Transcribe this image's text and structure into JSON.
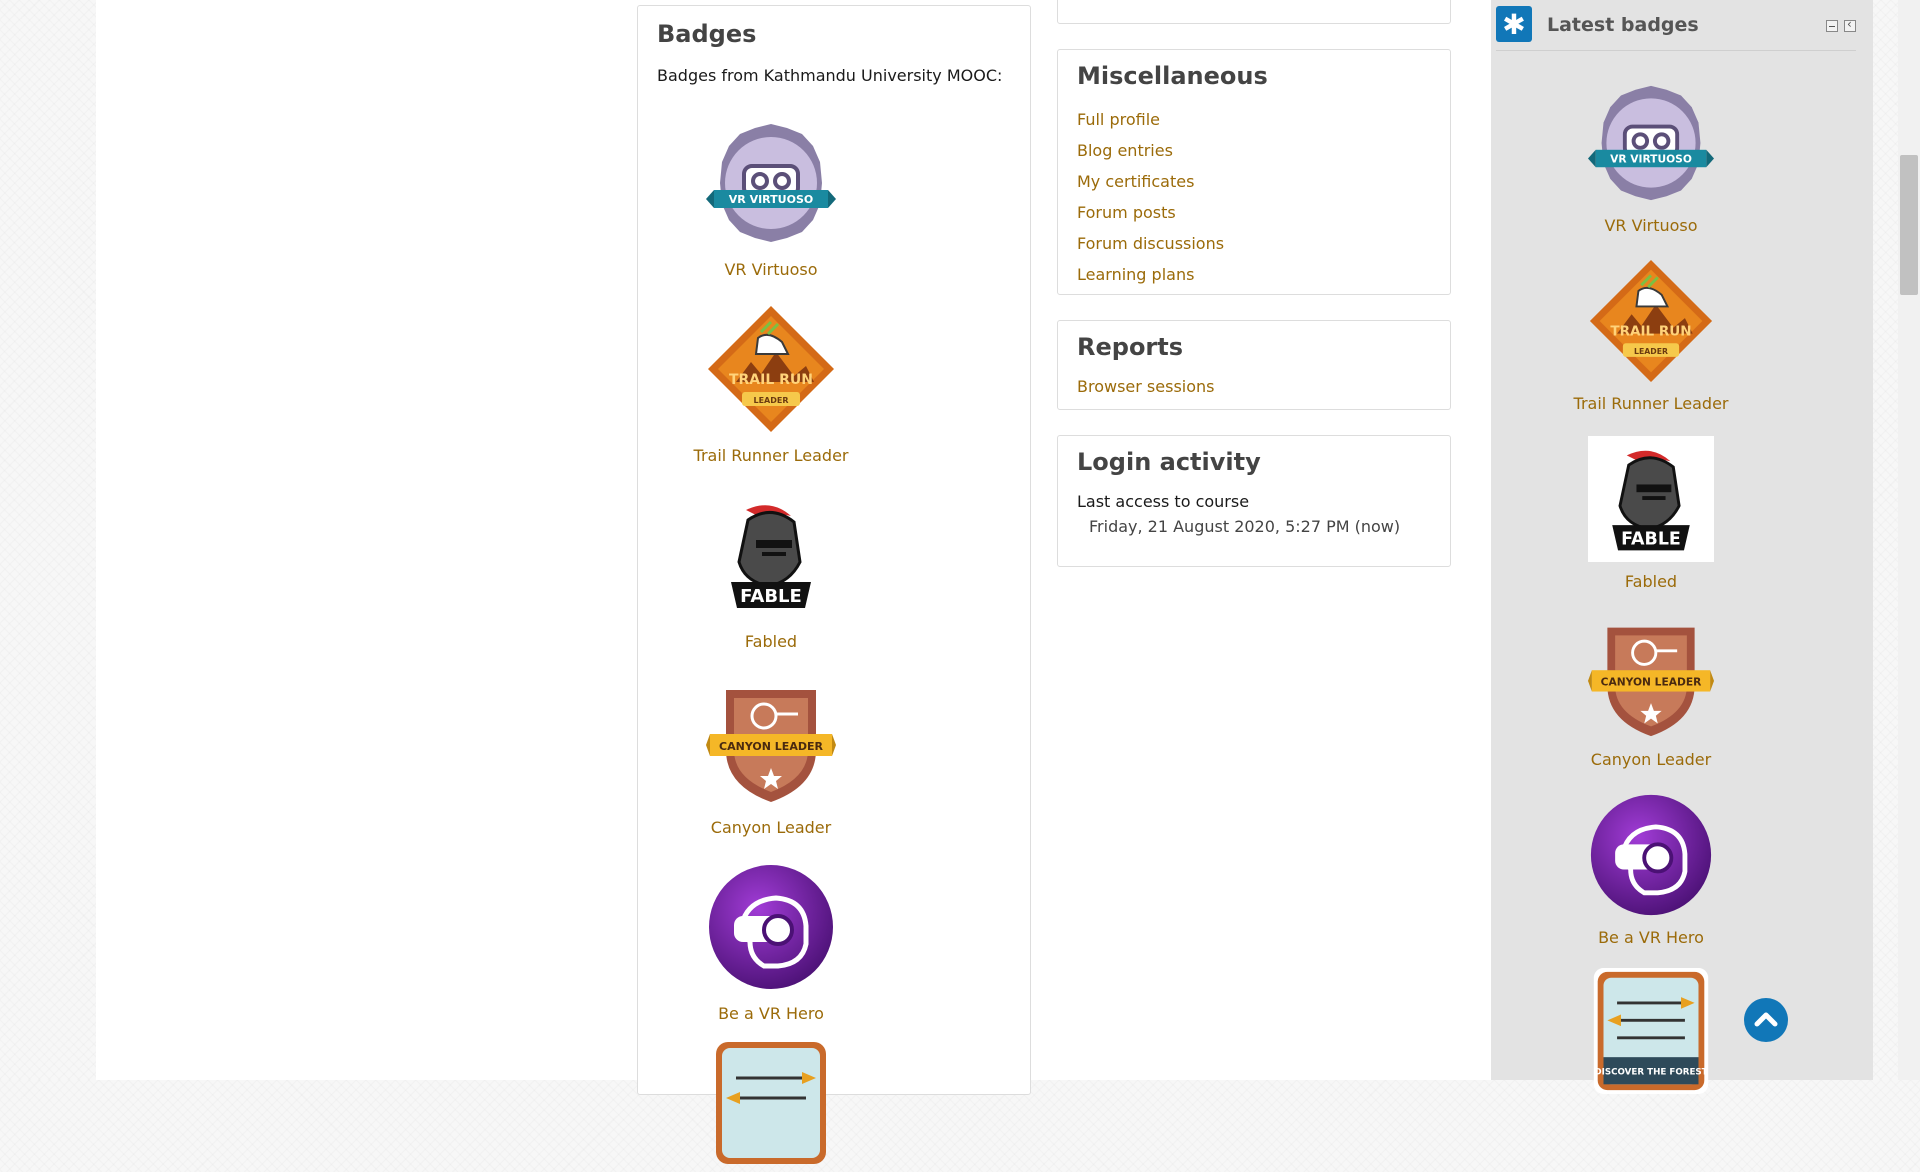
{
  "badges_card": {
    "title": "Badges",
    "intro": "Badges from Kathmandu University MOOC:",
    "items": [
      {
        "name": "VR Virtuoso",
        "icon": "vr-virtuoso-badge-icon",
        "label": "VR VIRTUOSO"
      },
      {
        "name": "Trail Runner Leader",
        "icon": "trail-run-leader-badge-icon",
        "label": "TRAIL RUN"
      },
      {
        "name": "Fabled",
        "icon": "fable-knight-badge-icon",
        "label": "FABLE"
      },
      {
        "name": "Canyon Leader",
        "icon": "canyon-leader-badge-icon",
        "label": "CANYON LEADER"
      },
      {
        "name": "Be a VR Hero",
        "icon": "vr-hero-badge-icon"
      },
      {
        "name": "",
        "icon": "discover-forest-badge-icon"
      }
    ]
  },
  "miscellaneous": {
    "title": "Miscellaneous",
    "links": [
      "Full profile",
      "Blog entries",
      "My certificates",
      "Forum posts",
      "Forum discussions",
      "Learning plans"
    ]
  },
  "reports": {
    "title": "Reports",
    "links": [
      "Browser sessions"
    ]
  },
  "login_activity": {
    "title": "Login activity",
    "label": "Last access to course",
    "value": "Friday, 21 August 2020, 5:27 PM  (now)"
  },
  "latest_badges": {
    "title": "Latest badges",
    "icon": "badge-block-icon",
    "items": [
      "VR Virtuoso",
      "Trail Runner Leader",
      "Fabled",
      "Canyon Leader",
      "Be a VR Hero"
    ],
    "partial_badge_label": "DISCOVER THE FOREST"
  },
  "colors": {
    "link": "#9b6b0a",
    "accent": "#1177b8"
  }
}
